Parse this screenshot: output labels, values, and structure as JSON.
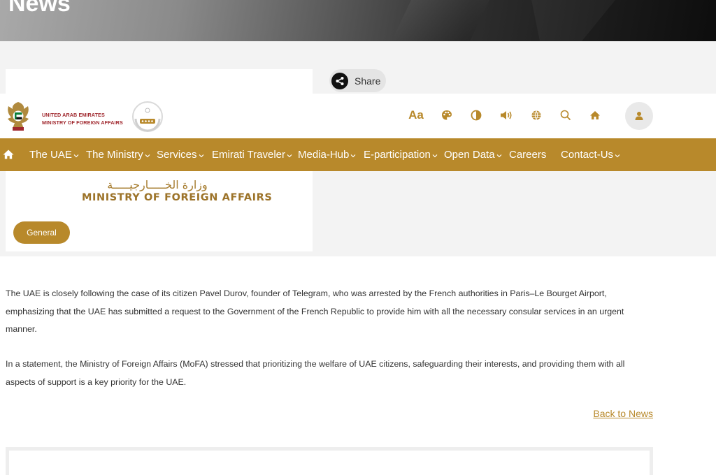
{
  "hero": {
    "title": "News"
  },
  "share": {
    "label": "Share"
  },
  "logo": {
    "line1": "UNITED ARAB EMIRATES",
    "line2": "MINISTRY OF FOREIGN AFFAIRS"
  },
  "toolbar": {
    "font_size_label": "Aa",
    "icons": [
      "font-size-icon",
      "palette-icon",
      "contrast-icon",
      "speaker-icon",
      "globe-icon",
      "search-icon",
      "home-icon",
      "user-icon"
    ]
  },
  "nav": {
    "items": [
      {
        "label": "The UAE",
        "has_dropdown": true
      },
      {
        "label": "The Ministry",
        "has_dropdown": true
      },
      {
        "label": "Services",
        "has_dropdown": true
      },
      {
        "label": "Emirati Traveler",
        "has_dropdown": true
      },
      {
        "label": "Media-Hub",
        "has_dropdown": true
      },
      {
        "label": "E-participation",
        "has_dropdown": true
      },
      {
        "label": "Open Data",
        "has_dropdown": true
      },
      {
        "label": "Careers",
        "has_dropdown": false
      },
      {
        "label": "Contact-Us",
        "has_dropdown": true
      }
    ]
  },
  "card": {
    "ministry_arabic": "وزارة الخـــــارجيـــــة",
    "ministry_english": "MINISTRY OF FOREIGN AFFAIRS",
    "category": "General"
  },
  "article": {
    "paragraph1": "The UAE is closely following the case of its citizen Pavel Durov, founder of Telegram, who was arrested by the French authorities in Paris–Le Bourget Airport, emphasizing that the UAE has submitted a request to the Government of the French Republic to provide him with all the necessary consular services in an urgent manner.",
    "paragraph2": "In a statement, the Ministry of Foreign Affairs (MoFA) stressed that prioritizing the welfare of UAE citizens, safeguarding their interests, and providing them with all aspects of support is a key priority for the UAE.",
    "back_link": "Back to News"
  },
  "colors": {
    "accent": "#b8892b",
    "nav_background": "#b8892b",
    "logo_red": "#a0282e"
  }
}
